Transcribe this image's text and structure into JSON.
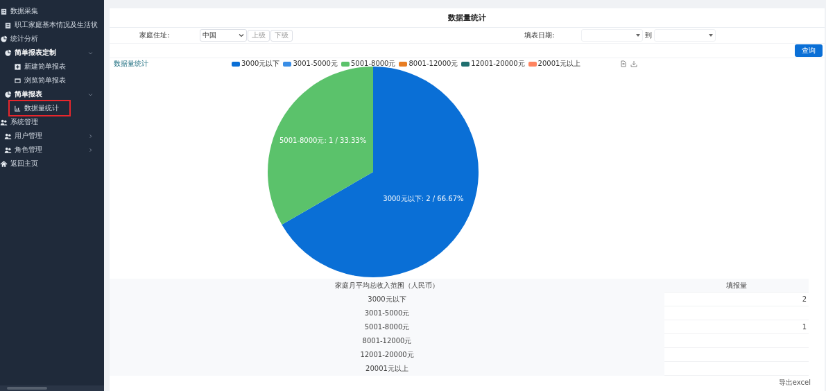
{
  "sidebar": {
    "items": [
      {
        "label": "数据采集",
        "children": [
          {
            "label": "职工家庭基本情况及生活状",
            "selected": false
          }
        ]
      },
      {
        "label": "统计分析",
        "children": [
          {
            "label": "简单报表定制",
            "expanded": true,
            "children": [
              {
                "label": "新建简单报表",
                "selected": false
              },
              {
                "label": "浏览简单报表",
                "selected": false
              }
            ]
          },
          {
            "label": "简单报表",
            "expanded": true,
            "children": [
              {
                "label": "数据量统计",
                "selected": true
              }
            ]
          }
        ]
      },
      {
        "label": "系统管理",
        "children": [
          {
            "label": "用户管理",
            "expanded": false
          },
          {
            "label": "角色管理",
            "expanded": false
          }
        ]
      },
      {
        "label": "返回主页"
      }
    ]
  },
  "page": {
    "title": "数据量统计"
  },
  "filters": {
    "address_label": "家庭住址:",
    "address_value": "中国",
    "up_button": "上级",
    "down_button": "下级",
    "date_label": "填表日期:",
    "date_separator": "到",
    "query_button": "查询"
  },
  "chart": {
    "title": "数据量统计",
    "legend": [
      {
        "color": "#0a6fd6"
      },
      {
        "color": "#3a8ee6"
      },
      {
        "color": "#5bc26b"
      },
      {
        "color": "#e87d22"
      },
      {
        "color": "#1f6f6f"
      },
      {
        "color": "#ff8561"
      }
    ],
    "chart_data": {
      "type": "pie",
      "categories": [
        "3000元以下",
        "3001-5000元",
        "5001-8000元",
        "8001-12000元",
        "12001-20000元",
        "20001元以上"
      ],
      "values": [
        66.67,
        0,
        33.33,
        0,
        0,
        0
      ],
      "value_labels": [
        "3000元以下: 2 / 66.67%",
        null,
        "5001-8000元: 1 / 33.33%",
        null,
        null,
        null
      ]
    }
  },
  "table": {
    "columns": [
      "家庭月平均总收入范围（人民币）",
      "填报量"
    ],
    "rows": [
      {
        "cells": [
          "3000元以下",
          "2"
        ]
      },
      {
        "cells": [
          "3001-5000元"
        ]
      },
      {
        "cells": [
          "5001-8000元",
          "1"
        ]
      },
      {
        "cells": [
          "8001-12000元"
        ]
      },
      {
        "cells": [
          "12001-20000元"
        ]
      },
      {
        "cells": [
          "20001元以上"
        ]
      }
    ]
  },
  "export_link": "导出excel"
}
